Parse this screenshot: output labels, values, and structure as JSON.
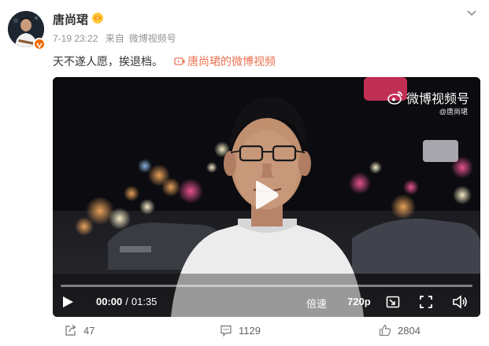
{
  "post": {
    "author": "唐尚珺",
    "time": "7-19 23:22",
    "source_prefix": "来自",
    "source": "微博视频号",
    "text": "天不遂人愿，挨退档。",
    "link_text": "唐尚珺的微博视频"
  },
  "video": {
    "watermark": "微博视频号",
    "handle": "@唐尚珺",
    "current_time": "00:00",
    "duration": "01:35",
    "speed_label": "倍速",
    "quality": "720p",
    "progress_fraction": 0
  },
  "actions": {
    "repost_count": "47",
    "comment_count": "1129",
    "like_count": "2804"
  },
  "icons": {
    "crown": "crown-icon",
    "link": "video-link-icon",
    "menu": "chevron-down-icon",
    "play": "play-icon",
    "repost": "repost-icon",
    "comment": "comment-icon",
    "like": "like-icon",
    "pip": "pip-icon",
    "fullscreen": "fullscreen-icon",
    "volume": "volume-icon"
  },
  "colors": {
    "link": "#eb7350",
    "verified": "#f56a00",
    "meta": "#939393"
  }
}
